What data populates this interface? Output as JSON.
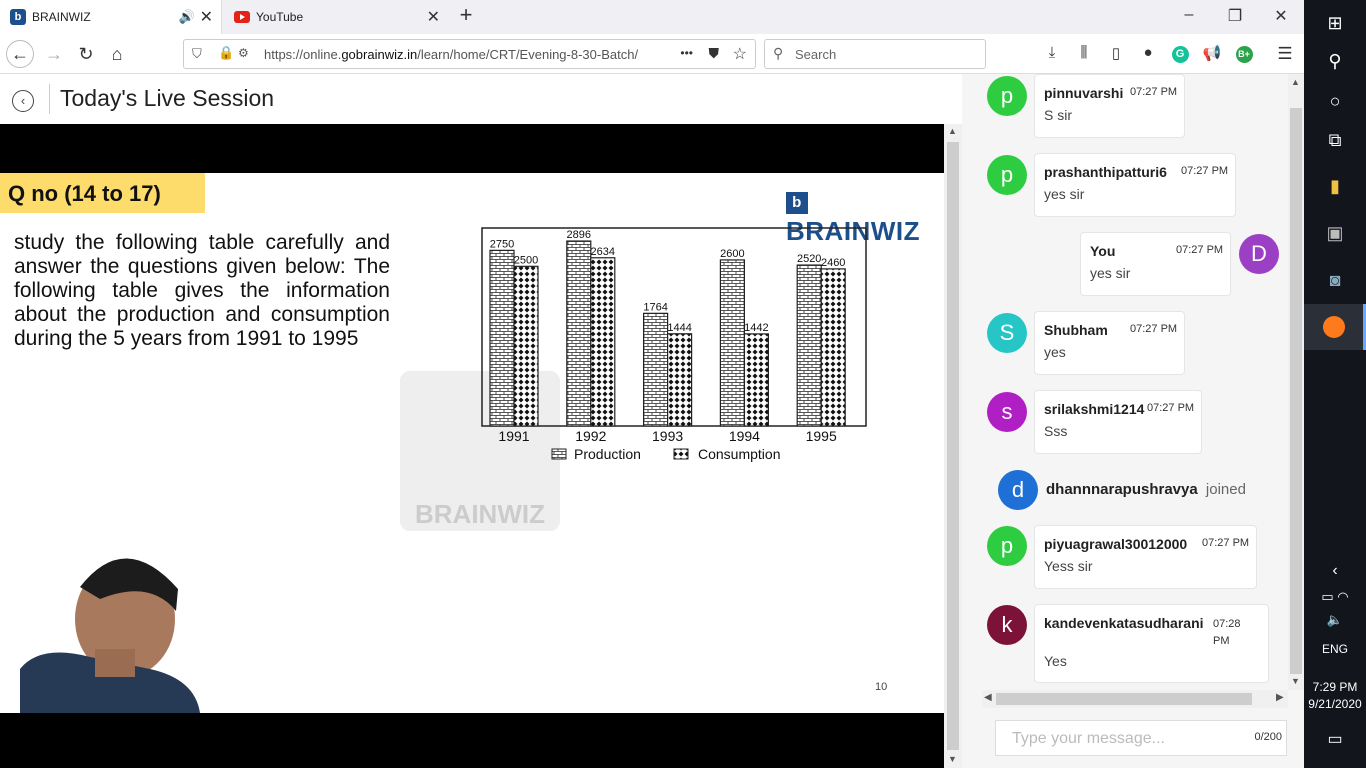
{
  "browser": {
    "tabs": [
      {
        "title": "BRAINWIZ",
        "active": true
      },
      {
        "title": "YouTube",
        "active": false
      }
    ],
    "url_prefix": "https://online.",
    "url_host": "gobrainwiz.in",
    "url_path": "/learn/home/CRT/Evening-8-30-Batch/",
    "search_placeholder": "Search",
    "overflow": "•••"
  },
  "page": {
    "title": "Today's Live Session"
  },
  "slide": {
    "qno": "Q no (14 to 17)",
    "brand": "BRAINWIZ",
    "question": "study the following table carefully and answer the questions given below: The following table gives the information about the production and consumption during the 5 years from 1991 to 1995",
    "watermark": "BRAINWIZ",
    "slide_number": "10"
  },
  "chart_data": {
    "type": "bar",
    "categories": [
      "1991",
      "1992",
      "1993",
      "1994",
      "1995"
    ],
    "series": [
      {
        "name": "Production",
        "values": [
          2750,
          2896,
          1764,
          2600,
          2520
        ]
      },
      {
        "name": "Consumption",
        "values": [
          2500,
          2634,
          1444,
          1442,
          2460
        ]
      }
    ],
    "title": "",
    "xlabel": "",
    "ylabel": "",
    "ylim": [
      0,
      3100
    ],
    "legend": "bottom",
    "grid": false
  },
  "chat": {
    "messages": [
      {
        "user": "pinnuvarshi",
        "time": "07:27 PM",
        "text": "S sir",
        "initial": "p",
        "color": "#2ecc40"
      },
      {
        "user": "prashanthipatturi6",
        "time": "07:27 PM",
        "text": "yes sir",
        "initial": "p",
        "color": "#2ecc40"
      },
      {
        "user": "You",
        "time": "07:27 PM",
        "text": "yes sir",
        "initial": "D",
        "color": "#9b3fc4"
      },
      {
        "user": "Shubham",
        "time": "07:27 PM",
        "text": "yes",
        "initial": "S",
        "color": "#26c6c6"
      },
      {
        "user": "srilakshmi1214",
        "time": "07:27 PM",
        "text": "Sss",
        "initial": "s",
        "color": "#b01fc4"
      },
      {
        "user": "piyuagrawal30012000",
        "time": "07:27 PM",
        "text": "Yess sir",
        "initial": "p",
        "color": "#2ecc40"
      },
      {
        "user": "kandevenkatasudharani",
        "time": "07:28 PM",
        "text": "Yes",
        "initial": "k",
        "color": "#7d1238"
      }
    ],
    "join": {
      "user": "dhannnarapushravya",
      "action": "joined",
      "initial": "d",
      "color": "#1e6fd6"
    },
    "input_placeholder": "Type your message...",
    "char_count": "0/200"
  },
  "taskbar": {
    "lang": "ENG",
    "time": "7:29 PM",
    "date": "9/21/2020"
  }
}
